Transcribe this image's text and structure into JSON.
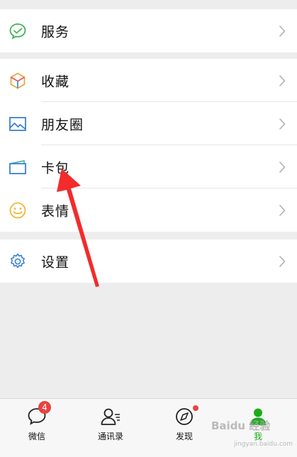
{
  "menu": {
    "group1": [
      {
        "label": "服务",
        "icon": "wechat-pay-icon"
      }
    ],
    "group2": [
      {
        "label": "收藏",
        "icon": "cube-icon"
      },
      {
        "label": "朋友圈",
        "icon": "picture-icon"
      },
      {
        "label": "卡包",
        "icon": "card-icon"
      },
      {
        "label": "表情",
        "icon": "smile-icon"
      }
    ],
    "group3": [
      {
        "label": "设置",
        "icon": "gear-icon"
      }
    ]
  },
  "tabs": [
    {
      "label": "微信",
      "icon": "chat-icon",
      "badge": "4"
    },
    {
      "label": "通讯录",
      "icon": "contacts-icon"
    },
    {
      "label": "发现",
      "icon": "compass-icon"
    },
    {
      "label": "我",
      "icon": "me-icon"
    }
  ],
  "watermark": {
    "text": "Baidu 经验",
    "sub": "jingyan.baidu.com"
  },
  "colors": {
    "accent": "#1aad19",
    "badge": "#e64340",
    "arrow": "#f32b2b"
  }
}
